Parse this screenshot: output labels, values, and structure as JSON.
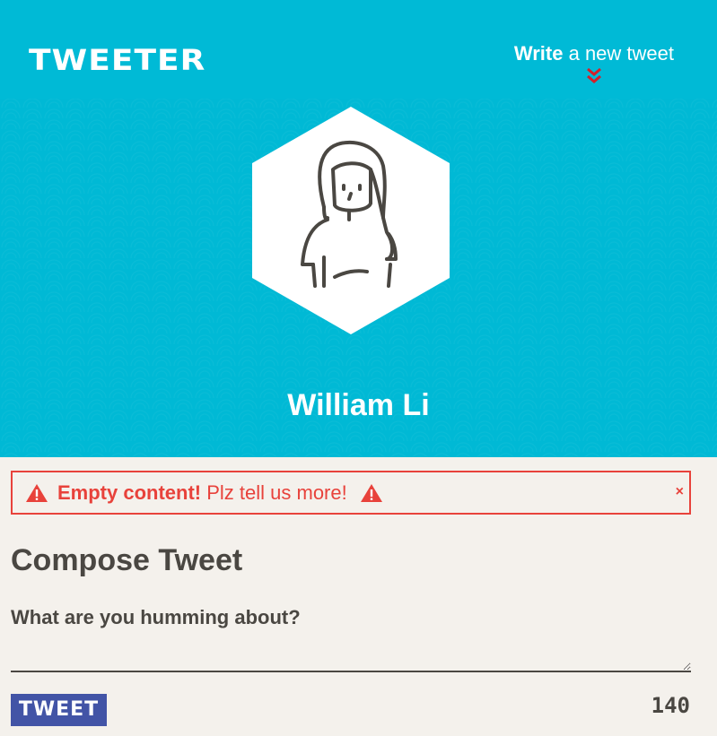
{
  "app": {
    "logo": "TWEETER"
  },
  "nav": {
    "compose_bold": "Write",
    "compose_rest": " a new tweet"
  },
  "profile": {
    "name": "William Li"
  },
  "alert": {
    "title": "Empty content!",
    "message": " Plz tell us more!",
    "close": "×"
  },
  "compose": {
    "title": "Compose Tweet",
    "placeholder": "What are you humming about?",
    "submit_label": "TWEET",
    "char_count": "140"
  },
  "colors": {
    "header_bg": "#00b9d5",
    "page_bg": "#f4f1ec",
    "alert_red": "#e8423b",
    "button_blue": "#4254a6",
    "text_dark": "#4a4742"
  },
  "icons": {
    "nav_chevron": "double-chevron-down-icon",
    "alert_warning": "warning-triangle-icon",
    "avatar": "user-avatar-illustration"
  }
}
